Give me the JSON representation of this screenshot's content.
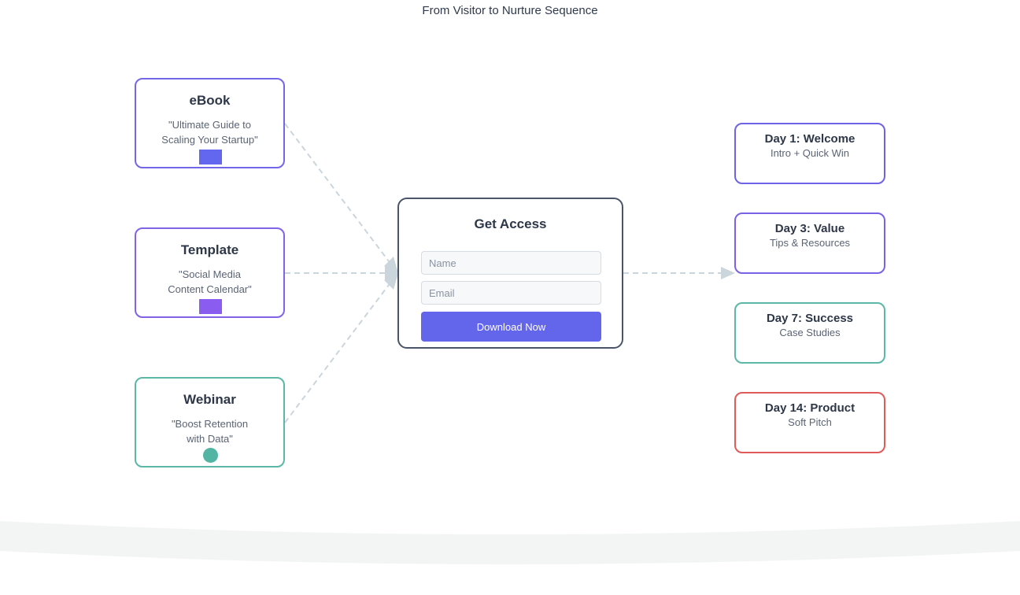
{
  "title": "From Visitor to Nurture Sequence",
  "colors": {
    "indigo": "#6366f1",
    "violet": "#8b5cf6",
    "teal": "#4fb3a0",
    "red": "#e05252",
    "slate": "#4a5568",
    "connector": "#cbd5dc",
    "band": "#f3f5f5"
  },
  "sources": [
    {
      "name": "eBook",
      "desc_line1": "\"Ultimate Guide to",
      "desc_line2": "Scaling Your Startup\"",
      "icon": "square-icon",
      "border": "#7466e8",
      "icon_color": "#6366ee"
    },
    {
      "name": "Template",
      "desc_line1": "\"Social Media",
      "desc_line2": "Content Calendar\"",
      "icon": "square-icon",
      "border": "#8063e6",
      "icon_color": "#8b5cf0"
    },
    {
      "name": "Webinar",
      "desc_line1": "\"Boost Retention",
      "desc_line2": "with Data\"",
      "icon": "circle-icon",
      "border": "#5cb8a6",
      "icon_color": "#52b5a3"
    }
  ],
  "form": {
    "heading": "Get Access",
    "name_placeholder": "Name",
    "email_placeholder": "Email",
    "button_label": "Download Now"
  },
  "sequence": [
    {
      "title": "Day 1: Welcome",
      "subtitle": "Intro + Quick Win",
      "border": "#6e63e6"
    },
    {
      "title": "Day 3: Value",
      "subtitle": "Tips & Resources",
      "border": "#7a62e6"
    },
    {
      "title": "Day 7: Success",
      "subtitle": "Case Studies",
      "border": "#5cb8a6"
    },
    {
      "title": "Day 14: Product",
      "subtitle": "Soft Pitch",
      "border": "#e05a5a"
    }
  ]
}
